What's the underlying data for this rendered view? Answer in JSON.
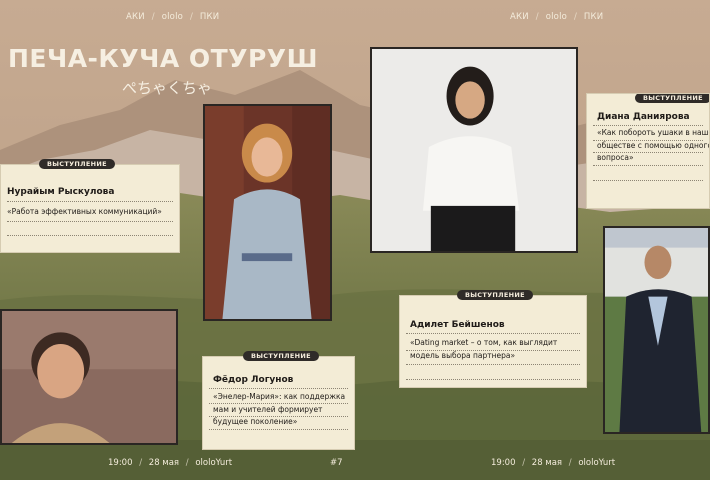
{
  "header": {
    "left_breadcrumb": [
      "АКИ",
      "ololo",
      "ПКИ"
    ],
    "right_breadcrumb": [
      "АКИ",
      "ololo",
      "ПКИ"
    ]
  },
  "event": {
    "title": "ПЕЧА-КУЧА ОТУРУШ",
    "subtitle": "ぺちゃくちゃ"
  },
  "footer": {
    "left": [
      "19:00",
      "28 мая",
      "ololoYurt"
    ],
    "page_number": "#7",
    "right": [
      "19:00",
      "28 мая",
      "ololoYurt"
    ]
  },
  "separator": "/",
  "speakers": [
    {
      "badge": "ВЫСТУПЛЕНИЕ",
      "name": "Нурайым Рыскулова",
      "talk": "«Работа эффективных коммуникаций»"
    },
    {
      "badge": "ВЫСТУПЛЕНИЕ",
      "name": "Фёдор Логунов",
      "talk": "«Энелер-Мария»: как поддержка мам и учителей формирует будущее поколение»"
    },
    {
      "badge": "ВЫСТУПЛЕНИЕ",
      "name": "Адилет Бейшенов",
      "talk": "«Dating market – о том, как выглядит модель выбора партнера»"
    },
    {
      "badge": "ВЫСТУПЛЕНИЕ",
      "name": "Диана Даниярова",
      "talk": "«Как побороть ушаки в нашем обществе с помощью одного вопроса»"
    }
  ],
  "colors": {
    "sky": "#c9ad94",
    "mountain": "#a98d78",
    "grass": "#7c7e4c",
    "card": "#f3ecd6",
    "badge": "#2f2b28",
    "text_light": "#f4ecdc"
  }
}
